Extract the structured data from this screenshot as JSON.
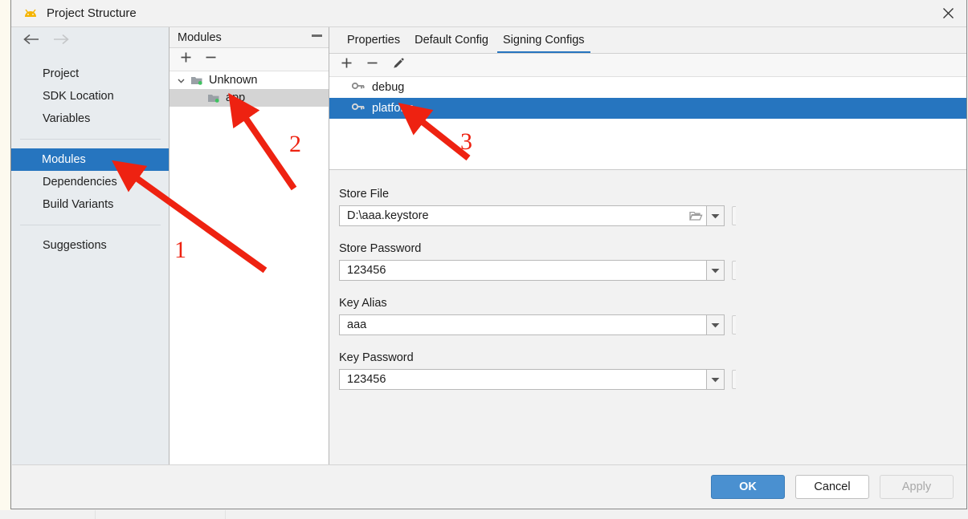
{
  "window": {
    "title": "Project Structure",
    "app_icon": "android-icon",
    "close_icon": "close-icon"
  },
  "nav": {
    "back_icon": "arrow-left-icon",
    "forward_icon": "arrow-right-icon"
  },
  "sidebar": {
    "items": [
      {
        "label": "Project",
        "selected": false
      },
      {
        "label": "SDK Location",
        "selected": false
      },
      {
        "label": "Variables",
        "selected": false
      },
      {
        "label": "Modules",
        "selected": true
      },
      {
        "label": "Dependencies",
        "selected": false
      },
      {
        "label": "Build Variants",
        "selected": false
      },
      {
        "label": "Suggestions",
        "selected": false
      }
    ]
  },
  "modules_panel": {
    "title": "Modules",
    "collapse_icon": "minimize-icon",
    "toolbar": {
      "add_icon": "plus-icon",
      "remove_icon": "minus-icon"
    },
    "tree": [
      {
        "label": "Unknown",
        "icon": "folder-module-icon",
        "expander": "chevron-down-icon",
        "selected": false
      },
      {
        "label": "app",
        "icon": "folder-module-icon",
        "selected": true
      }
    ]
  },
  "right_panel": {
    "tabs": [
      {
        "label": "Properties",
        "active": false
      },
      {
        "label": "Default Config",
        "active": false
      },
      {
        "label": "Signing Configs",
        "active": true
      }
    ],
    "toolbar": {
      "add_icon": "plus-icon",
      "remove_icon": "minus-icon",
      "edit_icon": "pencil-icon"
    },
    "configs": [
      {
        "label": "debug",
        "icon": "key-icon",
        "selected": false
      },
      {
        "label": "platform",
        "icon": "key-icon",
        "selected": true
      }
    ],
    "fields": [
      {
        "label": "Store File",
        "value": "D:\\aaa.keystore",
        "placeholder": "",
        "browse_icon": "folder-open-icon",
        "dropdown_icon": "chevron-down-icon",
        "has_browse": true
      },
      {
        "label": "Store Password",
        "value": "123456",
        "placeholder": "",
        "dropdown_icon": "chevron-down-icon",
        "has_browse": false
      },
      {
        "label": "Key Alias",
        "value": "aaa",
        "placeholder": "",
        "dropdown_icon": "chevron-down-icon",
        "has_browse": false
      },
      {
        "label": "Key Password",
        "value": "123456",
        "placeholder": "",
        "dropdown_icon": "chevron-down-icon",
        "has_browse": false
      }
    ]
  },
  "buttons": {
    "ok": "OK",
    "cancel": "Cancel",
    "apply": "Apply"
  },
  "annotations": {
    "marks": [
      {
        "number": "1",
        "points_to": "sidebar-item-modules"
      },
      {
        "number": "2",
        "points_to": "tree-item-app"
      },
      {
        "number": "3",
        "points_to": "config-item-platform"
      }
    ],
    "color": "#ee2211"
  }
}
